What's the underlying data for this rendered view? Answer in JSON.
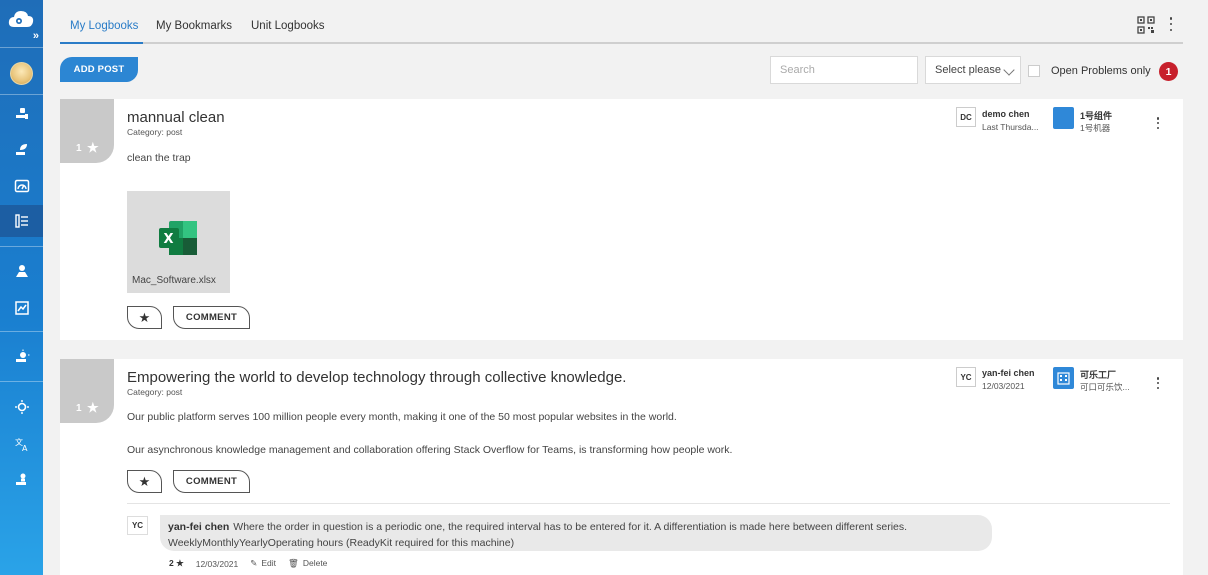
{
  "sidebar": {
    "logo_icon": "cloud-logo-icon",
    "expand_label": "»",
    "items": [
      {
        "name": "sidebar-item-1",
        "icon": "hand-gear-icon"
      },
      {
        "name": "sidebar-item-2",
        "icon": "hand-leaf-icon"
      },
      {
        "name": "sidebar-item-3",
        "icon": "dashboard-gauge-icon"
      },
      {
        "name": "sidebar-item-logbooks",
        "icon": "logbook-list-icon",
        "active": true
      },
      {
        "name": "sidebar-item-5",
        "icon": "worker-icon"
      },
      {
        "name": "sidebar-item-6",
        "icon": "chart-board-icon"
      },
      {
        "name": "sidebar-item-7",
        "icon": "hand-light-icon"
      },
      {
        "name": "sidebar-item-8",
        "icon": "settings-sun-icon"
      },
      {
        "name": "sidebar-item-9",
        "icon": "translate-icon"
      },
      {
        "name": "sidebar-item-10",
        "icon": "hand-person-icon"
      }
    ]
  },
  "tabs": [
    {
      "label": "My Logbooks",
      "active": true
    },
    {
      "label": "My Bookmarks",
      "active": false
    },
    {
      "label": "Unit Logbooks",
      "active": false
    }
  ],
  "toolbar": {
    "add_post_label": "ADD POST",
    "search_placeholder": "Search",
    "select_value": "Select please",
    "open_problems_label": "Open Problems only",
    "open_problems_count": "1"
  },
  "posts": [
    {
      "rating": "1",
      "title": "mannual clean",
      "category": "Category: post",
      "body": [
        "clean the trap"
      ],
      "attachment": {
        "name": "Mac_Software.xlsx",
        "icon": "excel-file-icon"
      },
      "author_initials": "DC",
      "author_name": "demo chen",
      "author_date": "Last Thursda...",
      "unit_name": "1号组件",
      "unit_sub": "1号机器",
      "comment_label": "COMMENT"
    },
    {
      "rating": "1",
      "title": "Empowering the world to develop technology through collective knowledge.",
      "category": "Category: post",
      "body": [
        "Our public platform serves 100 million people every month, making it one of the 50 most popular websites in the world.",
        "Our asynchronous knowledge management and collaboration offering Stack Overflow for Teams, is transforming how people work."
      ],
      "author_initials": "YC",
      "author_name": "yan-fei chen",
      "author_date": "12/03/2021",
      "unit_name": "可乐工厂",
      "unit_sub": "可口可乐饮...",
      "comment_label": "COMMENT",
      "comments": [
        {
          "initials": "YC",
          "author": "yan-fei chen",
          "text_line1": "Where the order in question is a periodic one, the required interval has to be entered for it. A differentiation is made here between different series.",
          "text_line2": "WeeklyMonthlyYearlyOperating hours (ReadyKit required for this machine)",
          "rating": "2 ★",
          "date": "12/03/2021",
          "edit_label": "Edit",
          "delete_label": "Delete"
        }
      ]
    }
  ],
  "colors": {
    "accent": "#2c86d3",
    "sidebar_top": "#1f6db8",
    "badge": "#c7202c",
    "excel_green": "#1d8a4c"
  }
}
